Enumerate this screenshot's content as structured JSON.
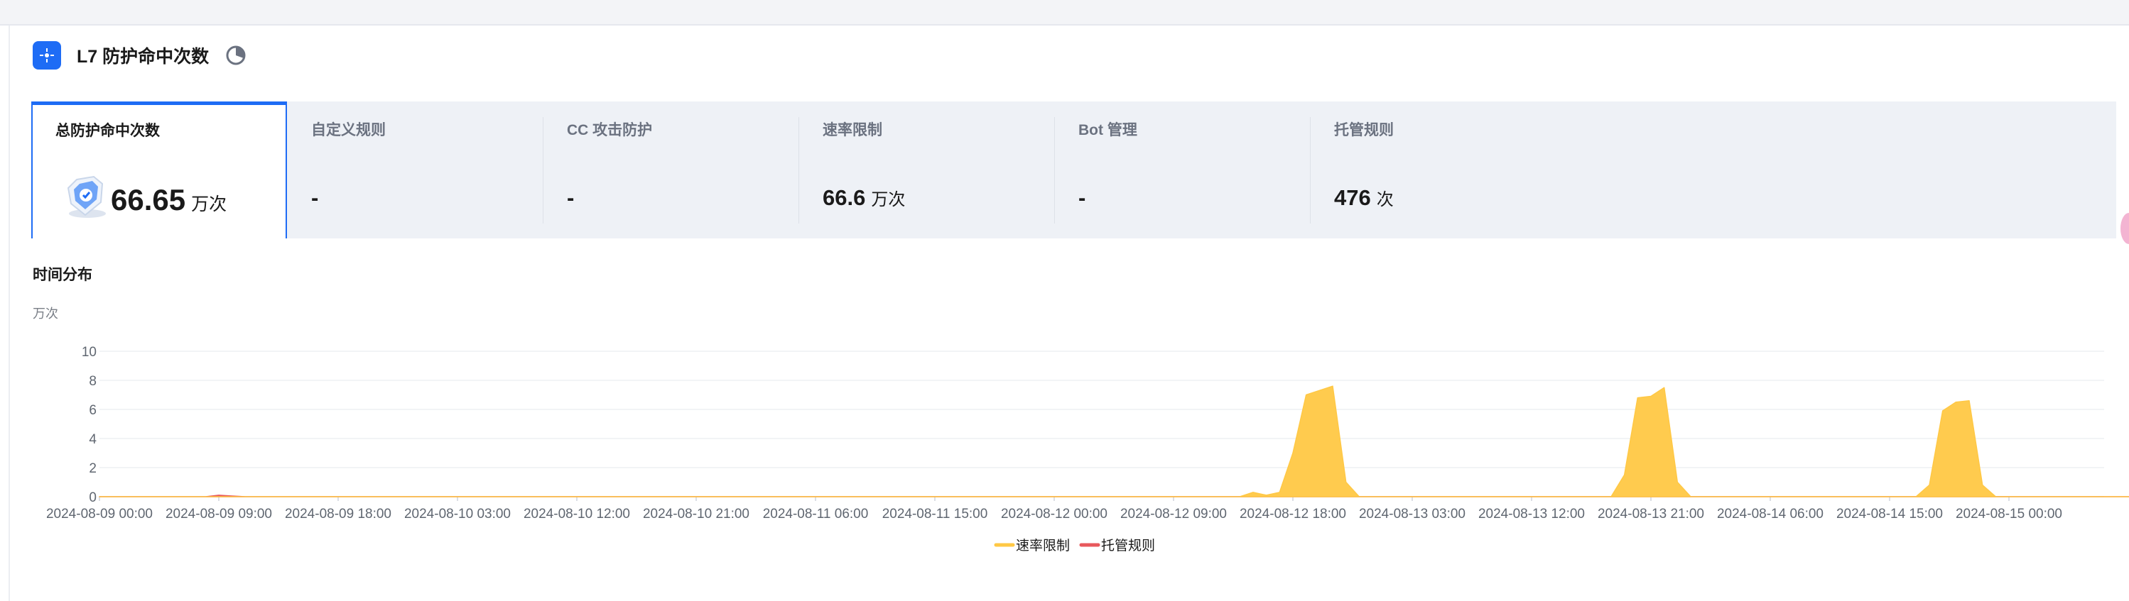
{
  "header": {
    "title": "L7 防护命中次数",
    "app_icon": "target-icon",
    "pie_icon": "pie-chart-icon"
  },
  "tabs": [
    {
      "label": "总防护命中次数",
      "value": "66.65",
      "unit": "万次",
      "active": true
    },
    {
      "label": "自定义规则",
      "value": "-",
      "unit": ""
    },
    {
      "label": "CC 攻击防护",
      "value": "-",
      "unit": ""
    },
    {
      "label": "速率限制",
      "value": "66.6",
      "unit": "万次"
    },
    {
      "label": "Bot 管理",
      "value": "-",
      "unit": ""
    },
    {
      "label": "托管规则",
      "value": "476",
      "unit": "次"
    }
  ],
  "section": {
    "title": "时间分布",
    "unit": "万次"
  },
  "chart_data": {
    "type": "area",
    "ylabel": "万次",
    "ylim": [
      0,
      10
    ],
    "yticks": [
      0,
      2,
      4,
      6,
      8,
      10
    ],
    "xlim": [
      "2024-08-09 00:00",
      "2024-08-15 15:00"
    ],
    "x_ticks": [
      "2024-08-09 00:00",
      "2024-08-09 09:00",
      "2024-08-09 18:00",
      "2024-08-10 03:00",
      "2024-08-10 12:00",
      "2024-08-10 21:00",
      "2024-08-11 06:00",
      "2024-08-11 15:00",
      "2024-08-12 00:00",
      "2024-08-12 09:00",
      "2024-08-12 18:00",
      "2024-08-13 03:00",
      "2024-08-13 12:00",
      "2024-08-13 21:00",
      "2024-08-14 06:00",
      "2024-08-14 15:00",
      "2024-08-15 00:00"
    ],
    "grid": true,
    "legend": "bottom-center",
    "series": [
      {
        "name": "速率限制",
        "color": "#ffc845",
        "points": [
          [
            "2024-08-09 00:00",
            0
          ],
          [
            "2024-08-12 14:00",
            0
          ],
          [
            "2024-08-12 15:00",
            0.3
          ],
          [
            "2024-08-12 16:00",
            0.1
          ],
          [
            "2024-08-12 17:00",
            0.3
          ],
          [
            "2024-08-12 18:00",
            3.0
          ],
          [
            "2024-08-12 19:00",
            7.0
          ],
          [
            "2024-08-12 20:00",
            7.3
          ],
          [
            "2024-08-12 21:00",
            7.6
          ],
          [
            "2024-08-12 22:00",
            1.0
          ],
          [
            "2024-08-12 23:00",
            0
          ],
          [
            "2024-08-13 18:00",
            0
          ],
          [
            "2024-08-13 19:00",
            1.5
          ],
          [
            "2024-08-13 20:00",
            6.8
          ],
          [
            "2024-08-13 21:00",
            6.9
          ],
          [
            "2024-08-13 22:00",
            7.5
          ],
          [
            "2024-08-13 23:00",
            1.0
          ],
          [
            "2024-08-14 00:00",
            0
          ],
          [
            "2024-08-14 17:00",
            0
          ],
          [
            "2024-08-14 18:00",
            0.8
          ],
          [
            "2024-08-14 19:00",
            5.9
          ],
          [
            "2024-08-14 20:00",
            6.5
          ],
          [
            "2024-08-14 21:00",
            6.6
          ],
          [
            "2024-08-14 22:00",
            0.8
          ],
          [
            "2024-08-14 23:00",
            0
          ],
          [
            "2024-08-15 15:00",
            0
          ]
        ]
      },
      {
        "name": "托管规则",
        "color": "#e8585c",
        "points": [
          [
            "2024-08-09 00:00",
            0
          ],
          [
            "2024-08-09 08:00",
            0
          ],
          [
            "2024-08-09 09:00",
            0.1
          ],
          [
            "2024-08-09 10:00",
            0.05
          ],
          [
            "2024-08-09 11:00",
            0
          ],
          [
            "2024-08-15 15:00",
            0
          ]
        ]
      }
    ]
  }
}
